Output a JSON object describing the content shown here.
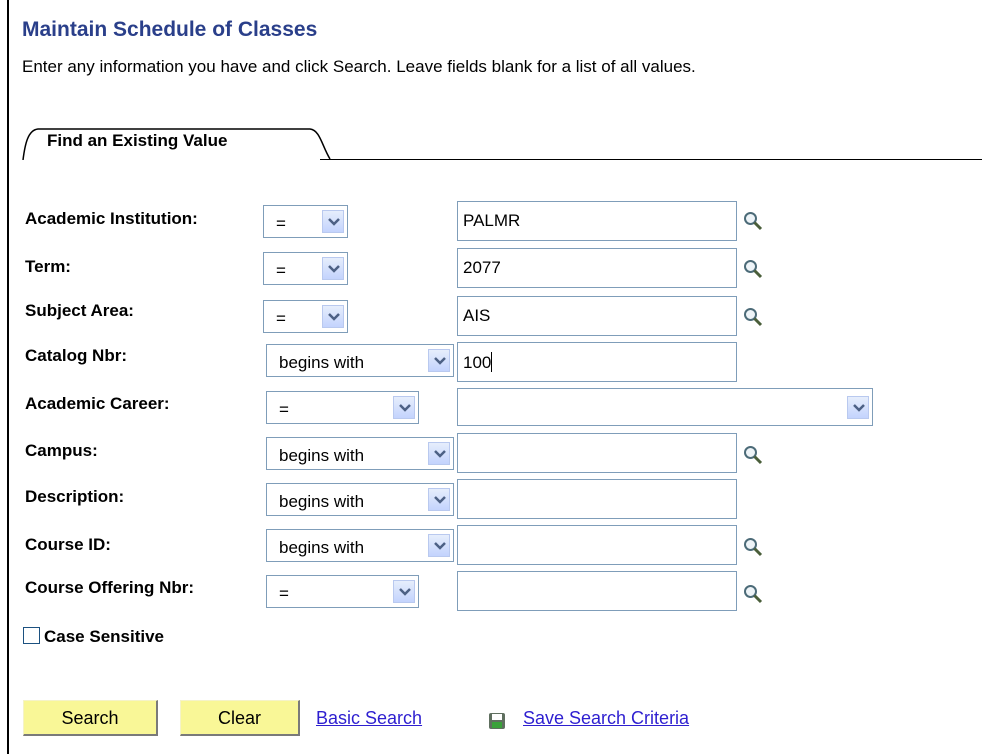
{
  "page": {
    "title": "Maintain Schedule of Classes",
    "instructions": "Enter any information you have and click Search. Leave fields blank for a list of all values."
  },
  "tab": {
    "label": "Find an Existing Value"
  },
  "fields": [
    {
      "label": "Academic Institution:",
      "operator": "=",
      "value": "PALMR",
      "lookup_icon": "magnifier-icon"
    },
    {
      "label": "Term:",
      "operator": "=",
      "value": "2077",
      "lookup_icon": "magnifier-icon"
    },
    {
      "label": "Subject Area:",
      "operator": "=",
      "value": "AIS",
      "lookup_icon": "magnifier-icon"
    },
    {
      "label": "Catalog Nbr:",
      "operator": "begins with",
      "value": "100"
    },
    {
      "label": "Academic Career:",
      "operator": "=",
      "value": ""
    },
    {
      "label": "Campus:",
      "operator": "begins with",
      "value": "",
      "lookup_icon": "magnifier-icon"
    },
    {
      "label": "Description:",
      "operator": "begins with",
      "value": ""
    },
    {
      "label": "Course ID:",
      "operator": "begins with",
      "value": "",
      "lookup_icon": "magnifier-icon"
    },
    {
      "label": "Course Offering Nbr:",
      "operator": "=",
      "value": "",
      "lookup_icon": "magnifier-icon"
    }
  ],
  "case_sensitive": {
    "label": "Case Sensitive",
    "checked": false
  },
  "actions": {
    "search": "Search",
    "clear": "Clear",
    "basic_search": "Basic Search",
    "save_icon": "save-icon",
    "save_search_criteria": "Save Search Criteria"
  },
  "colors": {
    "title": "#2a3f8a",
    "button_bg": "#f9f797",
    "link": "#2e1fd0",
    "field_border": "#7f9db9"
  }
}
